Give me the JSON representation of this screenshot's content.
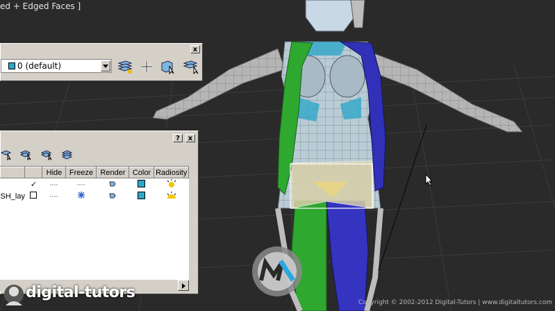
{
  "viewport": {
    "label": "ed + Edged Faces ]",
    "background": "#2a2a2a"
  },
  "layer_toolbar": {
    "close_label": "x",
    "current_layer": "0 (default)",
    "layer_color": "#2fa7c9",
    "tools": [
      "layers-icon",
      "new-layer-icon",
      "add-selection-icon",
      "select-objects-icon",
      "set-current-icon"
    ]
  },
  "layer_manager": {
    "help_label": "?",
    "close_label": "x",
    "tools": [
      "layer-tool-1-icon",
      "layer-tool-2-icon",
      "layer-tool-3-icon",
      "layer-tool-4-icon"
    ],
    "columns": [
      "",
      "Hide",
      "Freeze",
      "Render",
      "Color",
      "Radiosity"
    ],
    "rows": [
      {
        "name": "",
        "check": "✓",
        "color": "#2fa7c9"
      },
      {
        "name": "SH_lay",
        "check": "",
        "color": "#2fa7c9"
      }
    ]
  },
  "watermark": {
    "brand": "digital-tutors",
    "copyright": "Copyright © 2002-2012 Digital-Tutors  |  www.digitaltutors.com"
  }
}
